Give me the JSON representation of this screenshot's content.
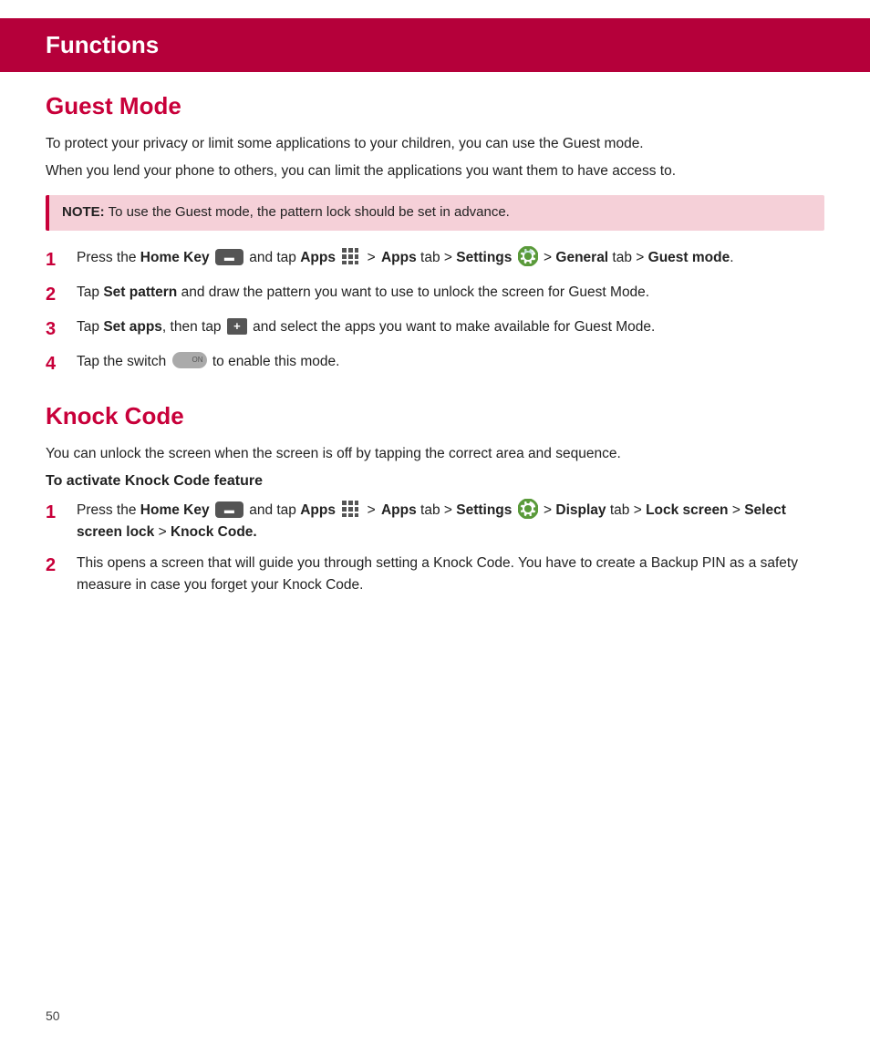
{
  "header": {
    "title": "Functions"
  },
  "guest_mode": {
    "title": "Guest Mode",
    "intro1": "To protect your privacy or limit some applications to your children, you can use the Guest mode.",
    "intro2": "When you lend your phone to others, you can limit the applications you want them to have access to.",
    "note": {
      "label": "NOTE:",
      "text": " To use the Guest mode, the pattern lock should be set in advance."
    },
    "steps": [
      {
        "num": "1",
        "text_parts": [
          {
            "type": "text",
            "val": "Press the "
          },
          {
            "type": "bold",
            "val": "Home Key"
          },
          {
            "type": "home-key"
          },
          {
            "type": "text",
            "val": " and tap "
          },
          {
            "type": "bold",
            "val": "Apps"
          },
          {
            "type": "apps-grid"
          },
          {
            "type": "arrow",
            "val": " > "
          },
          {
            "type": "bold",
            "val": "Apps"
          },
          {
            "type": "text",
            "val": " tab > "
          },
          {
            "type": "bold",
            "val": "Settings"
          },
          {
            "type": "settings-gear"
          },
          {
            "type": "arrow",
            "val": " > "
          },
          {
            "type": "bold",
            "val": "General"
          },
          {
            "type": "text",
            "val": " tab > "
          },
          {
            "type": "bold",
            "val": "Guest mode"
          },
          {
            "type": "text",
            "val": "."
          }
        ]
      },
      {
        "num": "2",
        "text_parts": [
          {
            "type": "text",
            "val": "Tap "
          },
          {
            "type": "bold",
            "val": "Set pattern"
          },
          {
            "type": "text",
            "val": " and draw the pattern you want to use to unlock the screen for Guest Mode."
          }
        ]
      },
      {
        "num": "3",
        "text_parts": [
          {
            "type": "text",
            "val": "Tap "
          },
          {
            "type": "bold",
            "val": "Set apps"
          },
          {
            "type": "text",
            "val": ", then tap "
          },
          {
            "type": "add-icon"
          },
          {
            "type": "text",
            "val": " and select the apps you want to make available for Guest Mode."
          }
        ]
      },
      {
        "num": "4",
        "text_parts": [
          {
            "type": "text",
            "val": "Tap the switch "
          },
          {
            "type": "toggle"
          },
          {
            "type": "text",
            "val": " to enable this mode."
          }
        ]
      }
    ]
  },
  "knock_code": {
    "title": "Knock Code",
    "intro": "You can unlock the screen when the screen is off by tapping the correct area and sequence.",
    "sub_heading": "To activate Knock Code feature",
    "steps": [
      {
        "num": "1",
        "text_parts": [
          {
            "type": "text",
            "val": "Press the "
          },
          {
            "type": "bold",
            "val": "Home Key"
          },
          {
            "type": "home-key"
          },
          {
            "type": "text",
            "val": " and tap "
          },
          {
            "type": "bold",
            "val": "Apps"
          },
          {
            "type": "apps-grid"
          },
          {
            "type": "arrow",
            "val": " > "
          },
          {
            "type": "bold",
            "val": "Apps"
          },
          {
            "type": "text",
            "val": " tab > "
          },
          {
            "type": "bold",
            "val": "Settings"
          },
          {
            "type": "settings-gear"
          },
          {
            "type": "arrow",
            "val": " > "
          },
          {
            "type": "bold",
            "val": "Display"
          },
          {
            "type": "text",
            "val": " tab > "
          },
          {
            "type": "bold",
            "val": "Lock screen"
          },
          {
            "type": "text",
            "val": " > "
          },
          {
            "type": "bold",
            "val": "Select screen lock"
          },
          {
            "type": "text",
            "val": " > "
          },
          {
            "type": "bold",
            "val": "Knock Code."
          }
        ]
      },
      {
        "num": "2",
        "text_parts": [
          {
            "type": "text",
            "val": "This opens a screen that will guide you through setting a Knock Code. You have to create a Backup PIN as a safety measure in case you forget your Knock Code."
          }
        ]
      }
    ]
  },
  "page_number": "50"
}
